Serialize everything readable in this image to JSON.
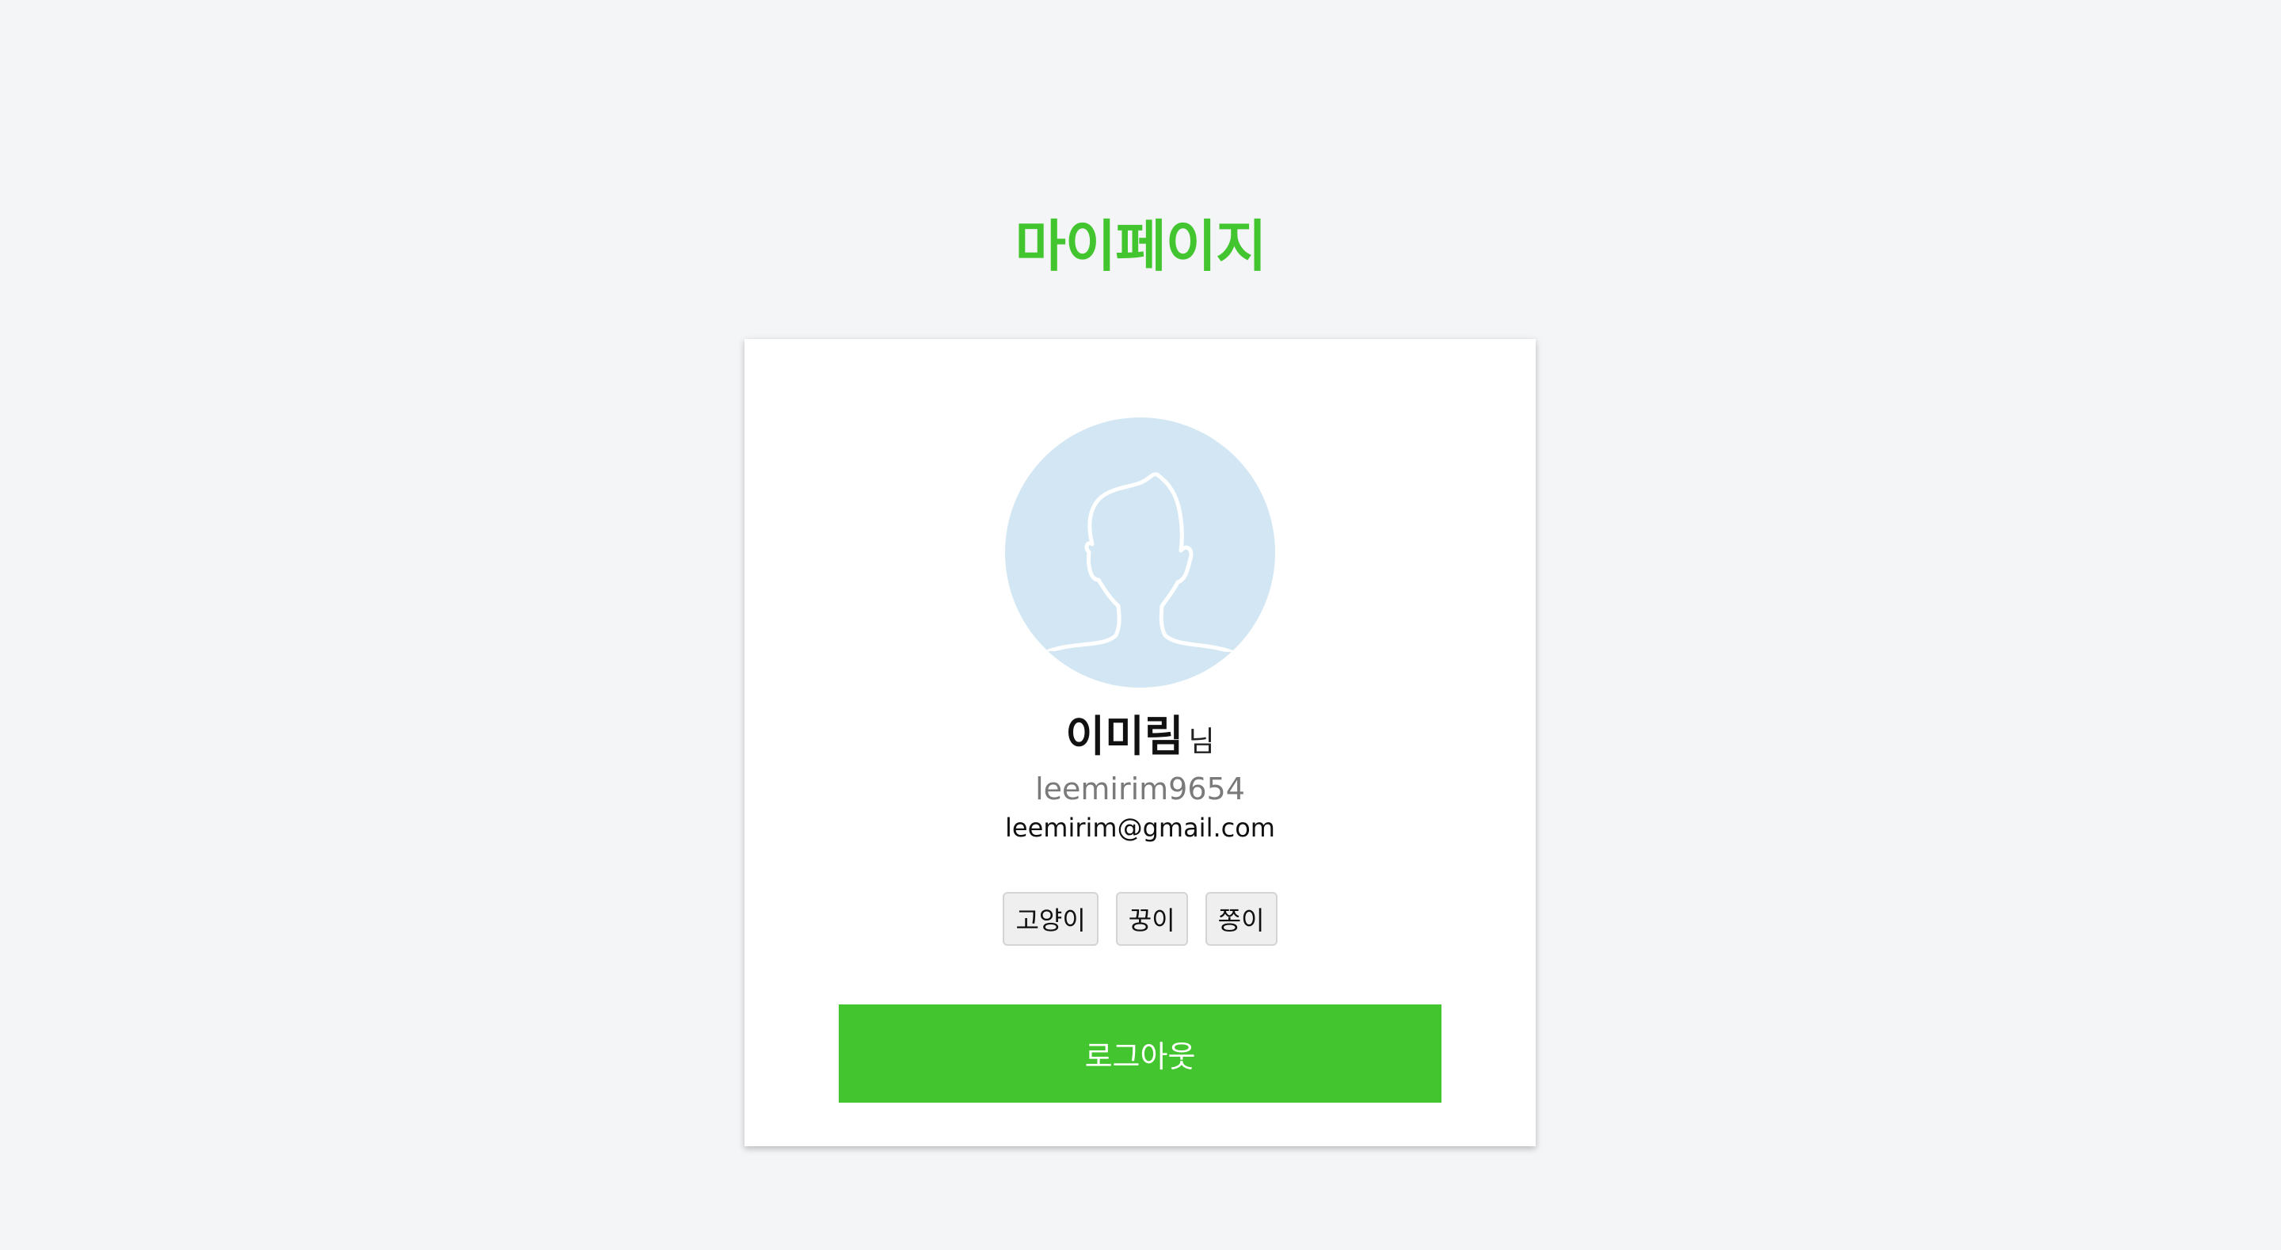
{
  "page": {
    "title": "마이페이지"
  },
  "profile": {
    "avatar_icon": "user-silhouette-icon",
    "name": "이미림",
    "name_suffix": "님",
    "username": "leemirim9654",
    "email": "leemirim@gmail.com",
    "tags": [
      "고양이",
      "꿍이",
      "쫑이"
    ]
  },
  "actions": {
    "logout_label": "로그아웃"
  },
  "colors": {
    "accent": "#43c52f",
    "background": "#f4f5f7",
    "avatar_bg": "#d2e7f3"
  }
}
